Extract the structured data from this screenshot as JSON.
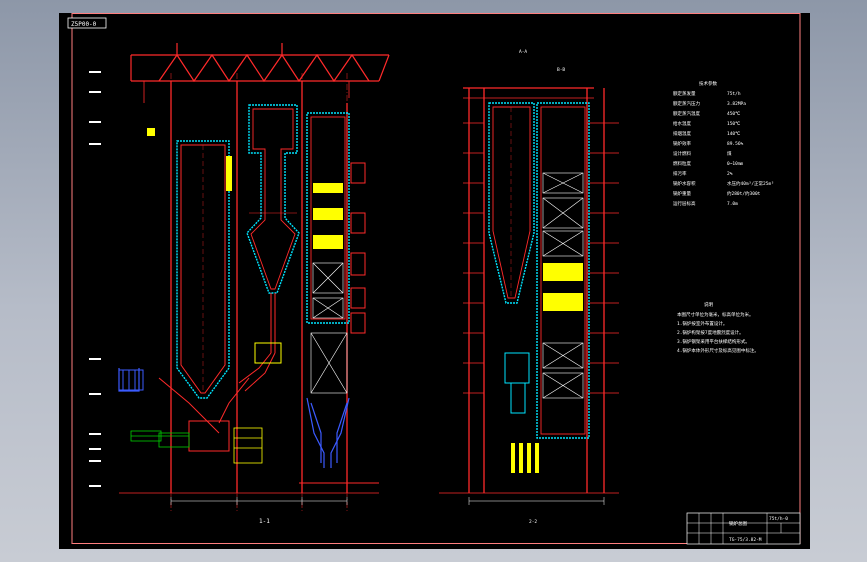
{
  "drawing": {
    "code_stamp": "Z5P00-0",
    "title_block": {
      "drawing_name": "锅炉总图",
      "drawing_number": "TG-75/3.82-M",
      "stage": "75t/h-0"
    },
    "views": {
      "left_view_label": "1-1",
      "right_view_label": "2-2",
      "right_header_label": "A-A",
      "right_header_label2": "B-B"
    },
    "specs": {
      "header": "技术参数",
      "rows": [
        {
          "name": "额定蒸发量",
          "value": "75t/h"
        },
        {
          "name": "额定蒸汽压力",
          "value": "3.82MPa"
        },
        {
          "name": "额定蒸汽温度",
          "value": "450℃"
        },
        {
          "name": "给水温度",
          "value": "150℃"
        },
        {
          "name": "排烟温度",
          "value": "140℃"
        },
        {
          "name": "锅炉效率",
          "value": "89.56%"
        },
        {
          "name": "设计燃料",
          "value": "煤"
        },
        {
          "name": "燃料粒度",
          "value": "0~10mm"
        },
        {
          "name": "排污率",
          "value": "2%"
        },
        {
          "name": "锅炉水容积",
          "value": "水压约40m³/正常25m³"
        },
        {
          "name": "锅炉重量",
          "value": "约280t/约300t"
        },
        {
          "name": "运行层标高",
          "value": "7.0m"
        }
      ]
    },
    "notes": {
      "header": "说明",
      "items": [
        "本图尺寸单位为毫米，标高单位为米。",
        "1.锅炉按室外布置设计。",
        "2.锅炉构架按7度地震烈度设计。",
        "3.锅炉钢架采用平台扶梯结构形式。",
        "4.锅炉本体外形尺寸及标高见图中标注。"
      ]
    },
    "colors": {
      "frame": "#ff2a2a",
      "outline": "#ff0000",
      "cyan": "#00e5ff",
      "yellow": "#ffff00",
      "blue": "#3b5bff",
      "green": "#00d000",
      "white": "#ffffff"
    }
  }
}
